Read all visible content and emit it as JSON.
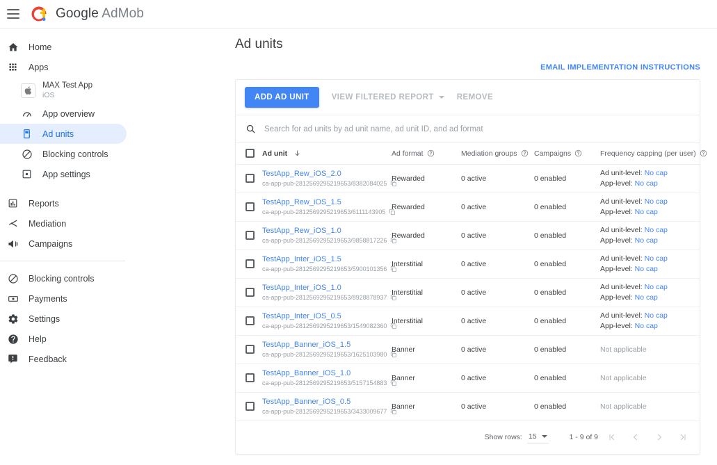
{
  "topbar": {
    "menu_icon": "hamburger-icon",
    "logo_icon": "admob-logo-icon",
    "brand_google": "Google",
    "brand_product": "AdMob"
  },
  "sidebar": {
    "items": [
      {
        "label": "Home",
        "icon": "home-icon"
      },
      {
        "label": "Apps",
        "icon": "apps-grid-icon"
      }
    ],
    "app": {
      "name": "MAX Test App",
      "platform": "iOS",
      "icon": "apple-icon"
    },
    "app_items": [
      {
        "label": "App overview",
        "icon": "speedometer-icon",
        "active": false
      },
      {
        "label": "Ad units",
        "icon": "mobile-ad-icon",
        "active": true
      },
      {
        "label": "Blocking controls",
        "icon": "block-circle-icon",
        "active": false
      },
      {
        "label": "App settings",
        "icon": "app-settings-icon",
        "active": false
      }
    ],
    "group2": [
      {
        "label": "Reports",
        "icon": "bar-chart-icon"
      },
      {
        "label": "Mediation",
        "icon": "mediation-icon"
      },
      {
        "label": "Campaigns",
        "icon": "megaphone-icon"
      }
    ],
    "group3": [
      {
        "label": "Blocking controls",
        "icon": "block-circle-icon"
      },
      {
        "label": "Payments",
        "icon": "money-icon"
      },
      {
        "label": "Settings",
        "icon": "gear-icon"
      },
      {
        "label": "Help",
        "icon": "help-circle-icon"
      },
      {
        "label": "Feedback",
        "icon": "feedback-icon"
      }
    ]
  },
  "main": {
    "page_title": "Ad units",
    "email_link": "EMAIL IMPLEMENTATION INSTRUCTIONS",
    "toolbar": {
      "add_label": "ADD AD UNIT",
      "view_report_label": "VIEW FILTERED REPORT",
      "remove_label": "REMOVE"
    },
    "search": {
      "placeholder": "Search for ad units by ad unit name, ad unit ID, and ad format",
      "value": "",
      "icon": "search-icon"
    },
    "table": {
      "headers": {
        "ad_unit": "Ad unit",
        "ad_format": "Ad format",
        "mediation_groups": "Mediation groups",
        "campaigns": "Campaigns",
        "frequency_capping": "Frequency capping (per user)"
      },
      "freq_labels": {
        "ad_unit_level": "Ad unit-level:",
        "app_level": "App-level:"
      },
      "rows": [
        {
          "name": "TestApp_Rew_iOS_2.0",
          "id": "ca-app-pub-2812569295219653/8382084025",
          "format": "Rewarded",
          "mediation": "0 active",
          "campaigns": "0 enabled",
          "freq_type": "cap",
          "ad_unit_cap": "No cap",
          "app_cap": "No cap"
        },
        {
          "name": "TestApp_Rew_iOS_1.5",
          "id": "ca-app-pub-2812569295219653/6111143905",
          "format": "Rewarded",
          "mediation": "0 active",
          "campaigns": "0 enabled",
          "freq_type": "cap",
          "ad_unit_cap": "No cap",
          "app_cap": "No cap"
        },
        {
          "name": "TestApp_Rew_iOS_1.0",
          "id": "ca-app-pub-2812569295219653/9858817226",
          "format": "Rewarded",
          "mediation": "0 active",
          "campaigns": "0 enabled",
          "freq_type": "cap",
          "ad_unit_cap": "No cap",
          "app_cap": "No cap"
        },
        {
          "name": "TestApp_Inter_iOS_1.5",
          "id": "ca-app-pub-2812569295219653/5900101356",
          "format": "Interstitial",
          "mediation": "0 active",
          "campaigns": "0 enabled",
          "freq_type": "cap",
          "ad_unit_cap": "No cap",
          "app_cap": "No cap"
        },
        {
          "name": "TestApp_Inter_iOS_1.0",
          "id": "ca-app-pub-2812569295219653/8928878937",
          "format": "Interstitial",
          "mediation": "0 active",
          "campaigns": "0 enabled",
          "freq_type": "cap",
          "ad_unit_cap": "No cap",
          "app_cap": "No cap"
        },
        {
          "name": "TestApp_Inter_iOS_0.5",
          "id": "ca-app-pub-2812569295219653/1549082360",
          "format": "Interstitial",
          "mediation": "0 active",
          "campaigns": "0 enabled",
          "freq_type": "cap",
          "ad_unit_cap": "No cap",
          "app_cap": "No cap"
        },
        {
          "name": "TestApp_Banner_iOS_1.5",
          "id": "ca-app-pub-2812569295219653/1625103980",
          "format": "Banner",
          "mediation": "0 active",
          "campaigns": "0 enabled",
          "freq_type": "na",
          "na_text": "Not applicable"
        },
        {
          "name": "TestApp_Banner_iOS_1.0",
          "id": "ca-app-pub-2812569295219653/5157154883",
          "format": "Banner",
          "mediation": "0 active",
          "campaigns": "0 enabled",
          "freq_type": "na",
          "na_text": "Not applicable"
        },
        {
          "name": "TestApp_Banner_iOS_0.5",
          "id": "ca-app-pub-2812569295219653/3433009677",
          "format": "Banner",
          "mediation": "0 active",
          "campaigns": "0 enabled",
          "freq_type": "na",
          "na_text": "Not applicable"
        }
      ]
    },
    "footer": {
      "show_rows_label": "Show rows:",
      "rows_per_page": "15",
      "range": "1 - 9 of 9",
      "first_icon": "first-page-icon",
      "prev_icon": "prev-page-icon",
      "next_icon": "next-page-icon",
      "last_icon": "last-page-icon"
    }
  },
  "colors": {
    "accent_blue": "#4285f4",
    "link_blue": "#1a73e8",
    "active_bg": "#e4eeff",
    "muted": "#9aa0a6"
  }
}
